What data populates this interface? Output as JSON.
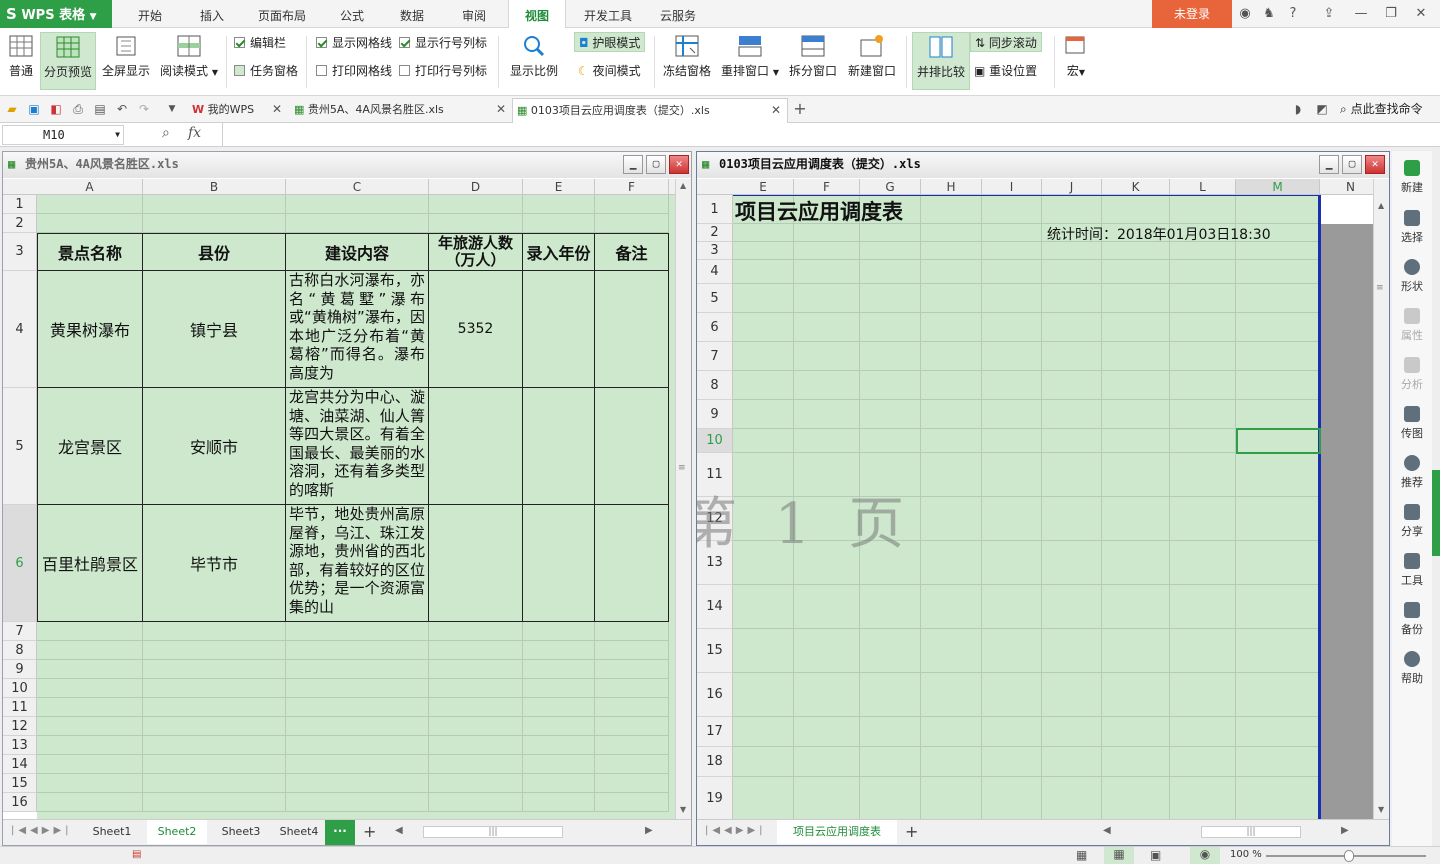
{
  "app": {
    "name": "WPS 表格"
  },
  "menu": [
    "开始",
    "插入",
    "页面布局",
    "公式",
    "数据",
    "审阅",
    "视图",
    "开发工具",
    "云服务"
  ],
  "menu_active": "视图",
  "login": "未登录",
  "ribbon": {
    "normal": "普通",
    "page_break_preview": "分页预览",
    "fullscreen": "全屏显示",
    "reading_mode": "阅读模式",
    "edit_bar": "编辑栏",
    "task_pane": "任务窗格",
    "show_gridlines": "显示网格线",
    "show_row_col_headers": "显示行号列标",
    "print_gridlines": "打印网格线",
    "print_row_col_headers": "打印行号列标",
    "zoom": "显示比例",
    "eye_protect": "护眼模式",
    "night_mode": "夜间模式",
    "freeze": "冻结窗格",
    "arrange": "重排窗口",
    "split": "拆分窗口",
    "new_window": "新建窗口",
    "side_by_side": "并排比较",
    "sync_scroll": "同步滚动",
    "reset_position": "重设位置",
    "macro": "宏"
  },
  "tabs": [
    {
      "label": "我的WPS"
    },
    {
      "label": "贵州5A、4A风景名胜区.xls"
    },
    {
      "label": "0103项目云应用调度表（提交）.xls"
    }
  ],
  "search_cmd": "点此查找命令",
  "formula": {
    "cell_ref": "M10",
    "fx": "fx"
  },
  "left_window": {
    "title": "贵州5A、4A风景名胜区.xls",
    "columns": [
      "A",
      "B",
      "C",
      "D",
      "E",
      "F"
    ],
    "rows": [
      "1",
      "2",
      "3",
      "4",
      "5",
      "6",
      "7",
      "8",
      "9",
      "10",
      "11",
      "12",
      "13",
      "14",
      "15",
      "16"
    ],
    "headers": [
      "景点名称",
      "县份",
      "建设内容",
      "年旅游人数（万人）",
      "录入年份",
      "备注"
    ],
    "data": [
      {
        "name": "黄果树瀑布",
        "county": "镇宁县",
        "content": "古称白水河瀑布，亦名“黄葛墅”瀑布或“黄桷树”瀑布，因本地广泛分布着“黄葛榕”而得名。瀑布高度为",
        "visitors": "5352"
      },
      {
        "name": "龙宫景区",
        "county": "安顺市",
        "content": "龙宫共分为中心、漩塘、油菜湖、仙人箐等四大景区。有着全国最长、最美丽的水溶洞，还有着多类型的喀斯",
        "visitors": ""
      },
      {
        "name": "百里杜鹃景区",
        "county": "毕节市",
        "content": "毕节，地处贵州高原屋脊，乌江、珠江发源地，贵州省的西北部，有着较好的区位优势；是一个资源富集的山",
        "visitors": ""
      }
    ],
    "sheets": [
      "Sheet1",
      "Sheet2",
      "Sheet3",
      "Sheet4"
    ],
    "active_sheet": "Sheet2"
  },
  "right_window": {
    "title": "0103项目云应用调度表（提交）.xls",
    "columns": [
      "E",
      "F",
      "G",
      "H",
      "I",
      "J",
      "K",
      "L",
      "M",
      "N"
    ],
    "rows": [
      "1",
      "2",
      "3",
      "4",
      "5",
      "6",
      "7",
      "8",
      "9",
      "10",
      "11",
      "12",
      "13",
      "14",
      "15",
      "16",
      "17",
      "18",
      "19"
    ],
    "sheet_title": "项目云应用调度表",
    "stat_time": "统计时间：2018年01月03日18:30",
    "watermark": "第 1 页",
    "sheets": [
      "项目云应用调度表"
    ]
  },
  "sidebar": [
    "新建",
    "选择",
    "形状",
    "属性",
    "分析",
    "传图",
    "推荐",
    "分享",
    "工具",
    "备份",
    "帮助"
  ],
  "status": {
    "zoom": "100 %"
  }
}
